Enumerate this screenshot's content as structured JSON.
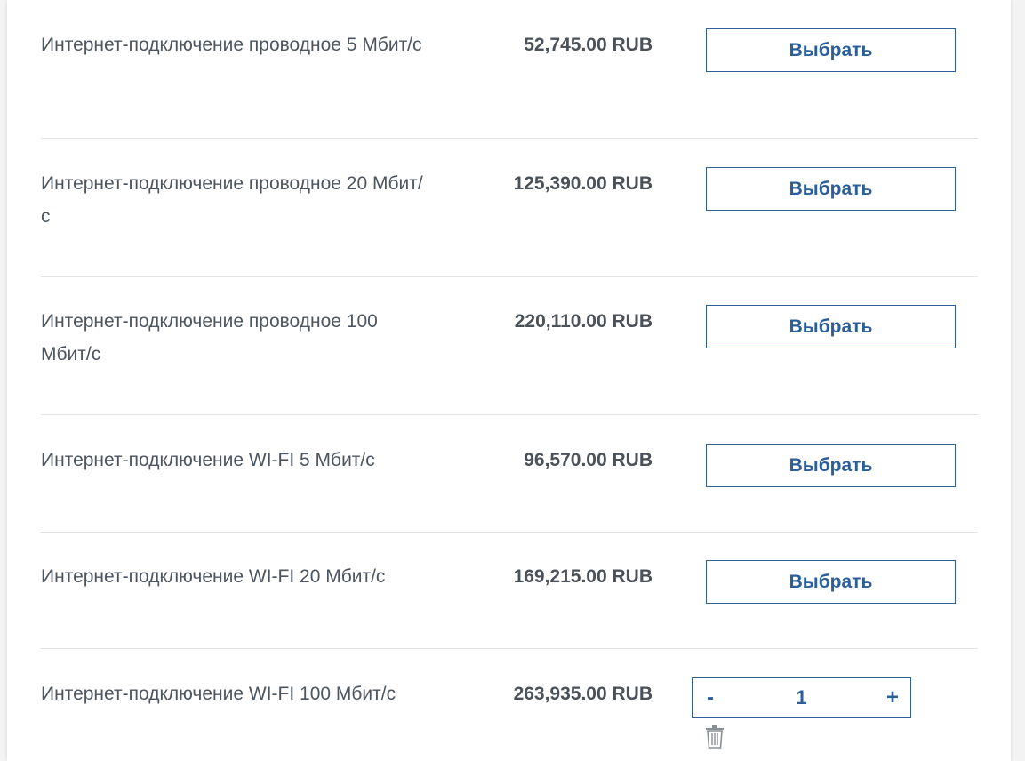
{
  "products": [
    {
      "name": "Интернет-подключение проводное 5 Мбит/с",
      "price": "52,745.00 RUB",
      "action": "Выбрать"
    },
    {
      "name": "Интернет-подключение проводное 20 Мбит/с",
      "price": "125,390.00 RUB",
      "action": "Выбрать"
    },
    {
      "name": "Интернет-подключение проводное 100 Мбит/с",
      "price": "220,110.00 RUB",
      "action": "Выбрать"
    },
    {
      "name": "Интернет-подключение WI-FI 5 Мбит/с",
      "price": "96,570.00 RUB",
      "action": "Выбрать"
    },
    {
      "name": "Интернет-подключение WI-FI 20 Мбит/с",
      "price": "169,215.00 RUB",
      "action": "Выбрать"
    },
    {
      "name": "Интернет-подключение WI-FI 100 Мбит/с",
      "price": "263,935.00 RUB",
      "stepper": {
        "minus": "-",
        "quantity": "1",
        "plus": "+"
      }
    }
  ],
  "icons": {
    "delete": "trash-icon"
  },
  "colors": {
    "accent": "#2c5f99",
    "text": "#4d5660",
    "divider": "#e3e3e3"
  }
}
